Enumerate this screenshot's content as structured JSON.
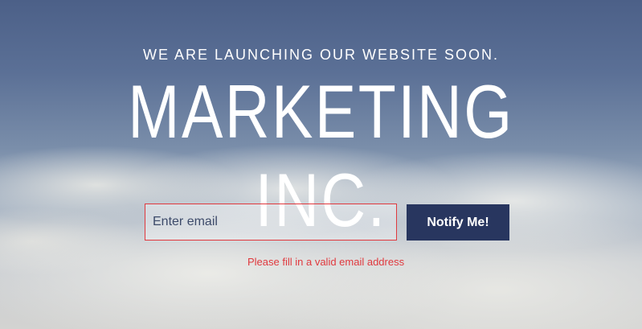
{
  "hero": {
    "tagline": "WE ARE LAUNCHING OUR WEBSITE SOON.",
    "brand": "MARKETING INC."
  },
  "form": {
    "email_placeholder": "Enter email",
    "email_value": "",
    "notify_label": "Notify Me!",
    "error_message": "Please fill in a valid email address"
  },
  "colors": {
    "button_bg": "#28365f",
    "error": "#e0393e",
    "text": "#ffffff"
  }
}
